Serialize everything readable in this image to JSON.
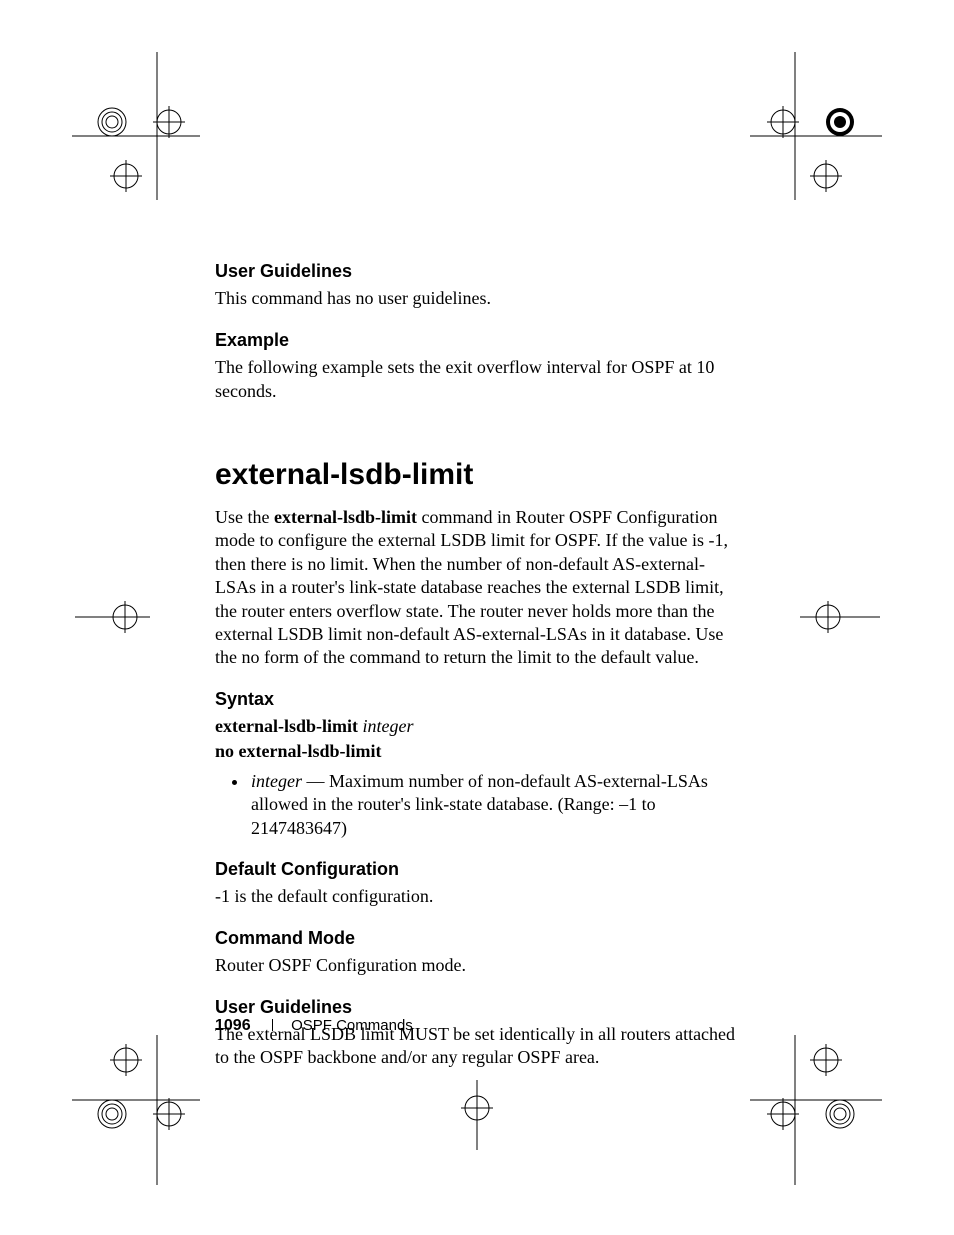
{
  "sections": {
    "ug1_head": "User Guidelines",
    "ug1_body": "This command has no user guidelines.",
    "ex_head": "Example",
    "ex_body": "The following example sets the exit overflow interval for OSPF at 10 seconds."
  },
  "command": {
    "title": "external-lsdb-limit",
    "intro_prefix": "Use the ",
    "intro_bold": "external-lsdb-limit",
    "intro_rest": " command in Router OSPF Configuration mode to configure the external LSDB limit for OSPF. If the value is -1, then there is no limit. When the number of non-default AS-external-LSAs in a router's link-state database reaches the external LSDB limit, the router enters overflow state. The router never holds more than the external LSDB limit non-default AS-external-LSAs in it database. Use the no form of the command to return the limit to the default value.",
    "syntax_head": "Syntax",
    "syntax_cmd": "external-lsdb-limit",
    "syntax_arg": "integer",
    "syntax_no": "no external-lsdb-limit",
    "bullet_arg": "integer",
    "bullet_text": " — Maximum number of non-default AS-external-LSAs allowed in the router's link-state database. (Range: –1 to 2147483647)",
    "default_head": "Default Configuration",
    "default_body": "-1 is the default configuration.",
    "mode_head": "Command Mode",
    "mode_body": "Router OSPF Configuration mode.",
    "ug2_head": "User Guidelines",
    "ug2_body": "The external LSDB limit MUST be set identically in all routers attached to the OSPF backbone and/or any regular OSPF area."
  },
  "footer": {
    "page": "1096",
    "chapter": "OSPF Commands"
  }
}
